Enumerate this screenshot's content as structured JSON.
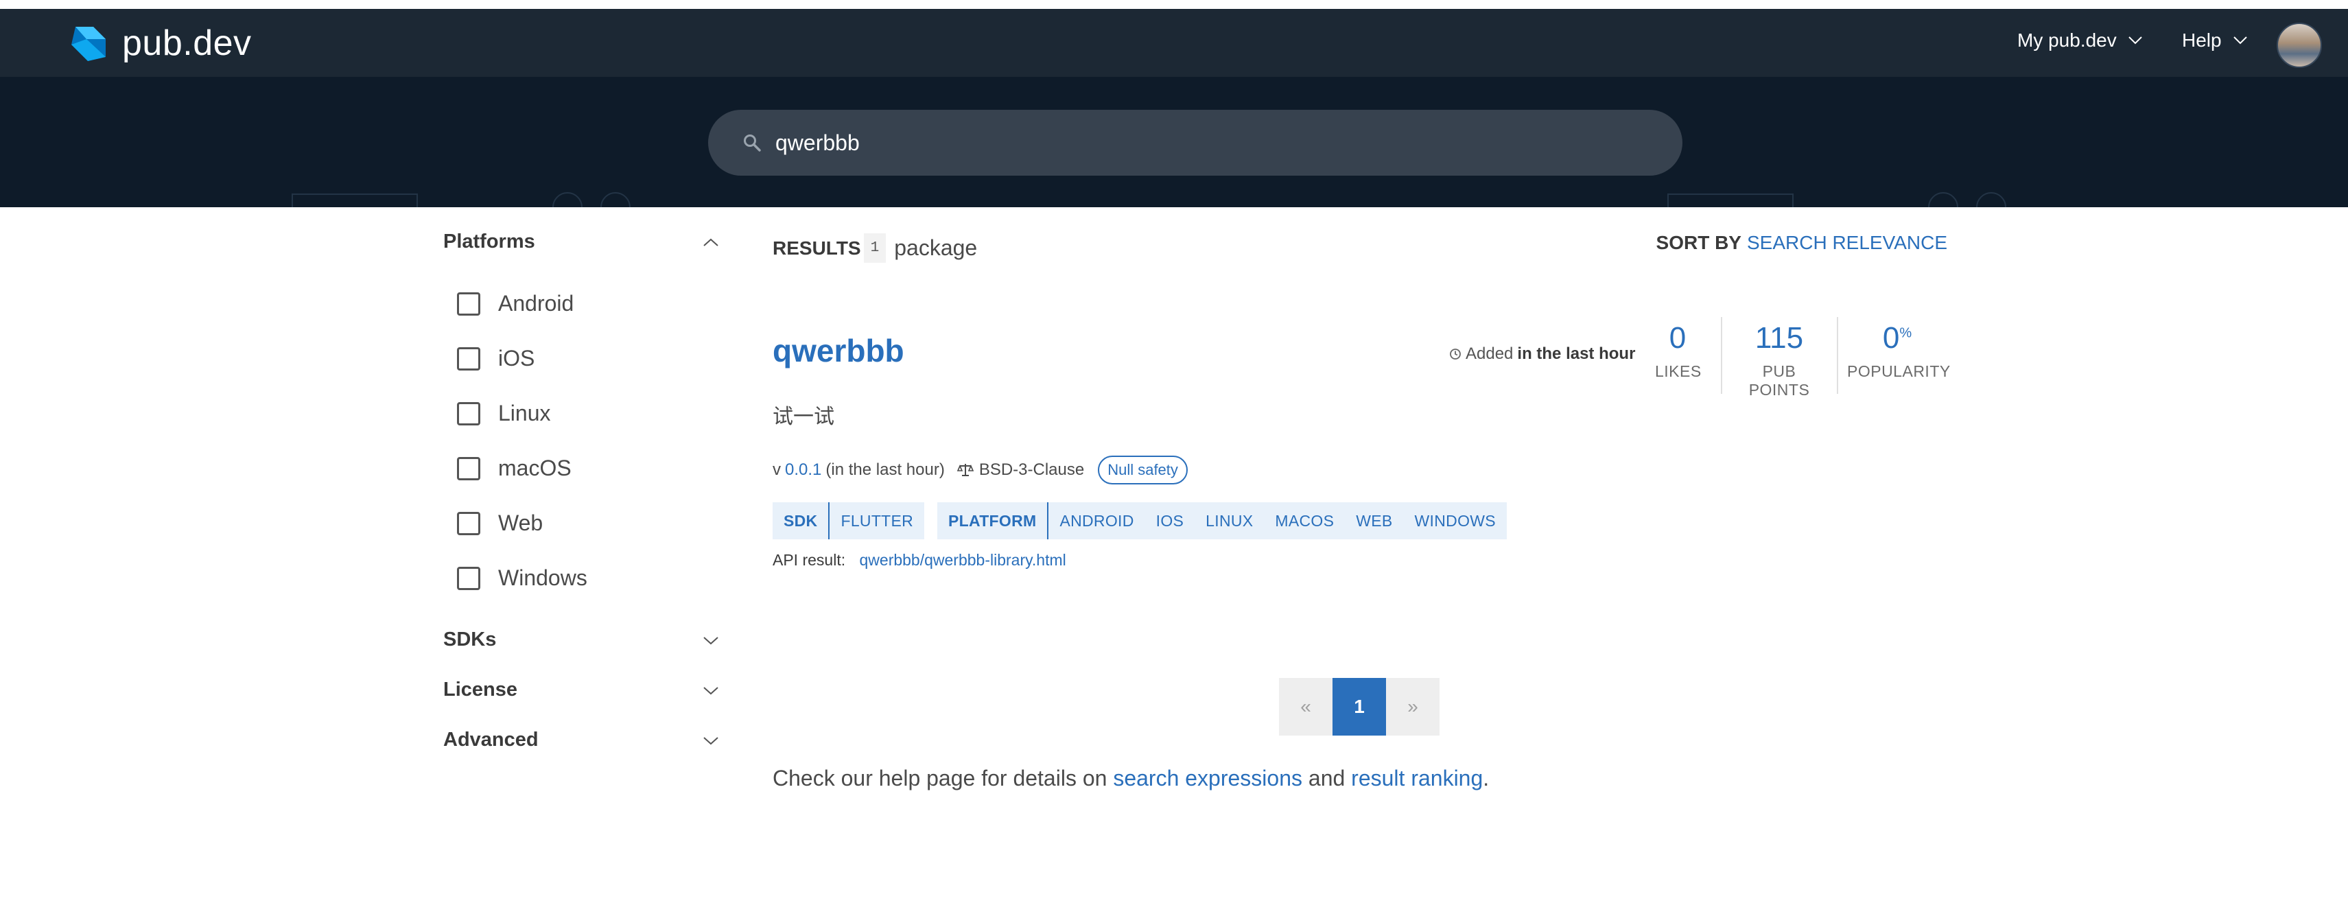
{
  "header": {
    "brand": "pub.dev",
    "nav": [
      {
        "label": "My pub.dev"
      },
      {
        "label": "Help"
      }
    ]
  },
  "search": {
    "value": "qwerbbb"
  },
  "sidebar": {
    "platforms_title": "Platforms",
    "platforms": [
      "Android",
      "iOS",
      "Linux",
      "macOS",
      "Web",
      "Windows"
    ],
    "sections": [
      "SDKs",
      "License",
      "Advanced"
    ]
  },
  "results": {
    "label": "RESULTS",
    "count": "1",
    "unit": "package",
    "sort_label": "SORT BY",
    "sort_value": "SEARCH RELEVANCE"
  },
  "package": {
    "name": "qwerbbb",
    "added_prefix": "Added",
    "added_when": "in the last hour",
    "description": "试一试",
    "version_prefix": "v",
    "version": "0.0.1",
    "version_when": "(in the last hour)",
    "license": "BSD-3-Clause",
    "null_safety": "Null safety",
    "metrics": [
      {
        "value": "0",
        "label": "LIKES"
      },
      {
        "value": "115",
        "label": "PUB POINTS"
      },
      {
        "value": "0",
        "unit": "%",
        "label": "POPULARITY"
      }
    ],
    "sdk_key": "SDK",
    "sdk_tags": [
      "FLUTTER"
    ],
    "platform_key": "PLATFORM",
    "platform_tags": [
      "ANDROID",
      "IOS",
      "LINUX",
      "MACOS",
      "WEB",
      "WINDOWS"
    ],
    "api_label": "API result:",
    "api_link": "qwerbbb/qwerbbb-library.html"
  },
  "pagination": {
    "prev": "«",
    "current": "1",
    "next": "»"
  },
  "help": {
    "prefix": "Check our help page for details on",
    "link1": "search expressions",
    "mid": "and",
    "link2": "result ranking",
    "suffix": "."
  },
  "colors": {
    "header_bg": "#1c2834",
    "banner_bg": "#0e1b29",
    "accent": "#2a6fbb",
    "tag_bg": "#e8f1fa"
  }
}
